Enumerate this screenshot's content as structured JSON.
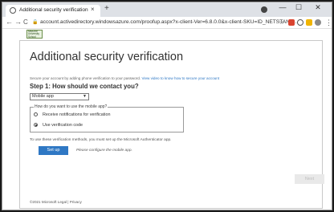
{
  "browser": {
    "tab_title": "Additional security verification",
    "tab_close": "×",
    "new_tab": "+",
    "minimize": "—",
    "maximize": "☐",
    "close": "✕",
    "back": "←",
    "forward": "→",
    "reload": "C",
    "lock": "🔒",
    "url": "account.activedirectory.windowsazure.com/proofup.aspx?x-client-Ver=6.8.0.0&x-client-SKU=ID_NETSTAND...",
    "star": "☆",
    "menu": "⋮",
    "favicon_icon": "globe-icon"
  },
  "page": {
    "logo_text": "Miss.the University School",
    "heading": "Additional security verification",
    "intro_text": "Secure your account by adding phone verification to your password.",
    "intro_link": "View video to know how to secure your account",
    "step_title": "Step 1: How should we contact you?",
    "method_select": "Mobile app",
    "legend": "How do you want to use the mobile app?",
    "options": [
      {
        "label": "Receive notifications for verification",
        "checked": false
      },
      {
        "label": "Use verification code",
        "checked": true
      }
    ],
    "note": "To use these verification methods, you must set up the Microsoft Authenticator app.",
    "setup_button": "Set up",
    "setup_hint": "Please configure the mobile app.",
    "next_button": "Next",
    "footer": "©2021 Microsoft   Legal  |  Privacy"
  },
  "colors": {
    "accent": "#2f78c4",
    "disabled_button": "#e9e9e9"
  }
}
